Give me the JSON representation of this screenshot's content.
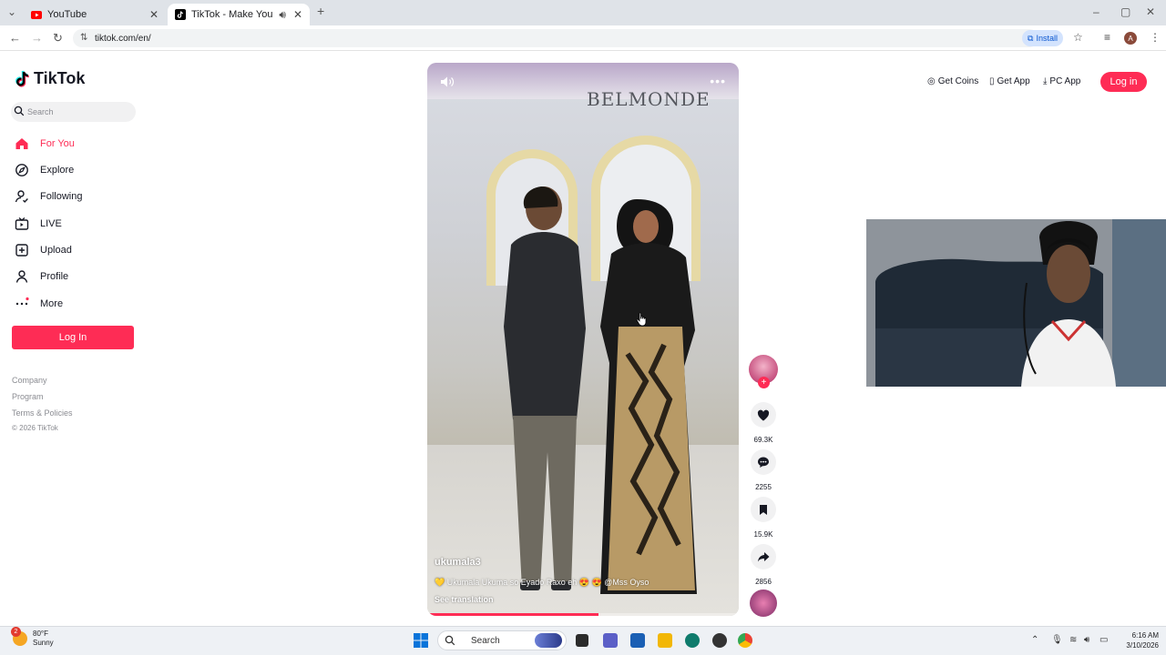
{
  "browser": {
    "tabs": [
      {
        "title": "YouTube",
        "close": "✕"
      },
      {
        "title": "TikTok - Make Your Day",
        "close": "✕"
      }
    ],
    "new_tab": "+",
    "url": "tiktok.com/en/",
    "install_label": "Install",
    "profile_initial": "A"
  },
  "sidebar": {
    "logo_text": "TikTok",
    "search_placeholder": "Search",
    "nav": [
      {
        "label": "For You",
        "icon": "home-icon"
      },
      {
        "label": "Explore",
        "icon": "compass-icon"
      },
      {
        "label": "Following",
        "icon": "following-icon"
      },
      {
        "label": "LIVE",
        "icon": "live-icon"
      },
      {
        "label": "Upload",
        "icon": "upload-icon"
      },
      {
        "label": "Profile",
        "icon": "profile-icon"
      },
      {
        "label": "More",
        "icon": "more-dots-icon"
      }
    ],
    "login_label": "Log In",
    "footer": [
      "Company",
      "Program",
      "Terms & Policies"
    ],
    "copyright": "© 2026 TikTok"
  },
  "video": {
    "sign_text": "BELMONDE",
    "username": "ukumala3",
    "caption": "💛 Ukumala Ukuma so Eyado Raxo eh 😍 😍 @Mss Oyso",
    "see_translation": "See translation",
    "progress": 0.55
  },
  "actions": {
    "likes": "69.3K",
    "comments": "2255",
    "saves": "15.9K",
    "shares": "2856"
  },
  "topbar": {
    "get_coins": "Get Coins",
    "get_app": "Get App",
    "pc_app": "PC App",
    "login": "Log in"
  },
  "taskbar": {
    "weather_temp": "80°F",
    "weather_desc": "Sunny",
    "weather_badge": "2",
    "search_placeholder": "Search",
    "time": "6:16 AM",
    "date": "3/10/2026"
  },
  "colors": {
    "accent": "#fe2c55",
    "text": "#161823",
    "muted": "#8a8b91"
  }
}
